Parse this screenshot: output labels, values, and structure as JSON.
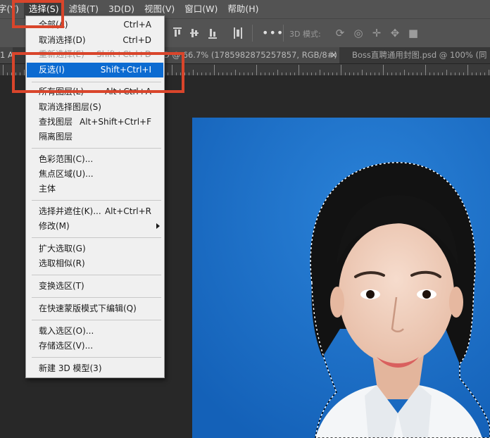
{
  "menubar": {
    "items": [
      {
        "label": "字(Y)"
      },
      {
        "label": "选择(S)"
      },
      {
        "label": "滤镜(T)"
      },
      {
        "label": "3D(D)"
      },
      {
        "label": "视图(V)"
      },
      {
        "label": "窗口(W)"
      },
      {
        "label": "帮助(H)"
      }
    ]
  },
  "optionsbar": {
    "more": "•••",
    "mode_3d_label": "3D 模式:"
  },
  "tabs": {
    "tab1": "1 A",
    "tab2": "D @ 66.7% (1785982875257857, RGB/8#) *",
    "tab2_close": "×",
    "tab3": "Boss直聘通用封图.psd @ 100% (同"
  },
  "select_menu": {
    "items": [
      {
        "label": "全部(A)",
        "shortcut": "Ctrl+A"
      },
      {
        "label": "取消选择(D)",
        "shortcut": "Ctrl+D"
      },
      {
        "label": "重新选择(E)",
        "shortcut": "Shift+Ctrl+D"
      },
      {
        "label": "反选(I)",
        "shortcut": "Shift+Ctrl+I"
      },
      {
        "label": "所有图层(L)",
        "shortcut": "Alt+Ctrl+A"
      },
      {
        "label": "取消选择图层(S)",
        "shortcut": ""
      },
      {
        "label": "查找图层",
        "shortcut": "Alt+Shift+Ctrl+F"
      },
      {
        "label": "隔离图层",
        "shortcut": ""
      },
      {
        "label": "色彩范围(C)...",
        "shortcut": ""
      },
      {
        "label": "焦点区域(U)...",
        "shortcut": ""
      },
      {
        "label": "主体",
        "shortcut": ""
      },
      {
        "label": "选择并遮住(K)...",
        "shortcut": "Alt+Ctrl+R"
      },
      {
        "label": "修改(M)",
        "shortcut": ""
      },
      {
        "label": "扩大选取(G)",
        "shortcut": ""
      },
      {
        "label": "选取相似(R)",
        "shortcut": ""
      },
      {
        "label": "变换选区(T)",
        "shortcut": ""
      },
      {
        "label": "在快速蒙版模式下编辑(Q)",
        "shortcut": ""
      },
      {
        "label": "载入选区(O)...",
        "shortcut": ""
      },
      {
        "label": "存储选区(V)...",
        "shortcut": ""
      },
      {
        "label": "新建 3D 模型(3)",
        "shortcut": ""
      }
    ]
  },
  "colors": {
    "menubar_bg": "#535353",
    "menu_bg": "#f0f0f0",
    "highlight": "#0c6bd1",
    "annotation": "#d9452b",
    "photo_bg": "#1a6cc4"
  }
}
